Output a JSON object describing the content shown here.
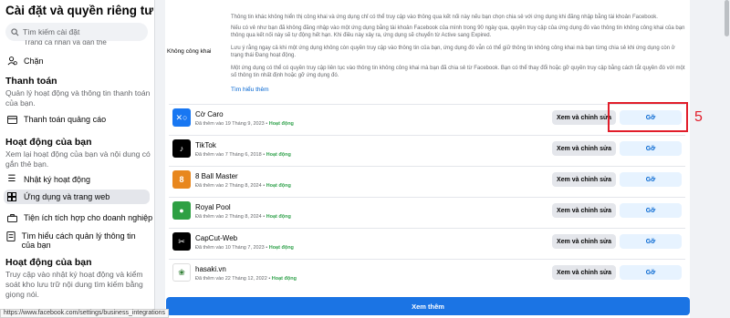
{
  "sidebar": {
    "title": "Cài đặt và quyền riêng tư",
    "search_placeholder": "Tìm kiếm cài đặt",
    "partial_item": "Trang cá nhân và gắn thẻ",
    "block_label": "Chặn",
    "payments_heading": "Thanh toán",
    "payments_desc": "Quản lý hoạt động và thông tin thanh toán của bạn.",
    "ads_payments_label": "Thanh toán quảng cáo",
    "activity_heading": "Hoạt động của bạn",
    "activity_desc": "Xem lại hoạt động của bạn và nội dung có gắn thẻ bạn.",
    "activity_log_label": "Nhật ký hoạt động",
    "apps_label": "Ứng dụng và trang web",
    "business_label": "Tiện ích tích hợp cho doanh nghiệp",
    "manage_info_label": "Tìm hiểu cách quản lý thông tin của bạn",
    "your_activity_heading": "Hoạt động của bạn",
    "your_activity_desc": "Truy cập vào nhật ký hoạt động và kiểm soát kho lưu trữ nội dung tìm kiếm bằng giọng nói."
  },
  "info": {
    "label": "Không công khai",
    "para1": "Thông tin khác không hiển thị công khai và ứng dụng chỉ có thể truy cập vào thông qua kết nối này nếu bạn chọn chia sẻ với ứng dụng khi đăng nhập bằng tài khoản Facebook.",
    "para2": "Nếu có vẻ như bạn đã không đăng nhập vào một ứng dụng bằng tài khoản Facebook của mình trong 90 ngày qua, quyền truy cập của ứng dụng đó vào thông tin không công khai của bạn thông qua kết nối này sẽ tự động hết hạn. Khi điều này xảy ra, ứng dụng sẽ chuyển từ Active sang Expired.",
    "para3": "Lưu ý rằng ngay cả khi một ứng dụng không còn quyền truy cập vào thông tin của bạn, ứng dụng đó vẫn có thể giữ thông tin không công khai mà bạn từng chia sẻ khi ứng dụng còn ở trạng thái Đang hoạt động.",
    "para4": "Một ứng dụng có thể có quyền truy cập liên tục vào thông tin không công khai mà bạn đã chia sẻ từ Facebook. Bạn có thể thay đổi hoặc gỡ quyền truy cập bằng cách tắt quyền đó với một số thông tin nhất định hoặc gỡ ứng dụng đó.",
    "learn_more": "Tìm hiểu thêm"
  },
  "apps": [
    {
      "name": "Cờ Caro",
      "added": "Đã thêm vào 19 Tháng 9, 2023 • ",
      "status": "Hoạt động",
      "icon": "caro-icon",
      "color": "#1877f2",
      "glyph": "✕○"
    },
    {
      "name": "TikTok",
      "added": "Đã thêm vào 7 Tháng 6, 2018 • ",
      "status": "Hoạt động",
      "icon": "tiktok-icon",
      "color": "#000000",
      "glyph": "♪"
    },
    {
      "name": "8 Ball Master",
      "added": "Đã thêm vào 2 Tháng 8, 2024 • ",
      "status": "Hoạt động",
      "icon": "8ball-icon",
      "color": "#e8871e",
      "glyph": "8"
    },
    {
      "name": "Royal Pool",
      "added": "Đã thêm vào 2 Tháng 8, 2024 • ",
      "status": "Hoạt động",
      "icon": "royal-pool-icon",
      "color": "#2ea043",
      "glyph": "●"
    },
    {
      "name": "CapCut-Web",
      "added": "Đã thêm vào 10 Tháng 7, 2023 • ",
      "status": "Hoạt động",
      "icon": "capcut-icon",
      "color": "#000000",
      "glyph": "✂"
    },
    {
      "name": "hasaki.vn",
      "added": "Đã thêm vào 22 Tháng 12, 2022 • ",
      "status": "Hoạt động",
      "icon": "hasaki-icon",
      "color": "#ffffff",
      "glyph": "❀"
    }
  ],
  "buttons": {
    "edit": "Xem và chỉnh sửa",
    "remove": "Gỡ",
    "see_more": "Xem thêm"
  },
  "annotation": "5",
  "status_url": "https://www.facebook.com/settings/business_integrations",
  "colors": {
    "accent": "#1b74e4",
    "active_green": "#31a24c",
    "highlight_red": "#e11d2a"
  }
}
